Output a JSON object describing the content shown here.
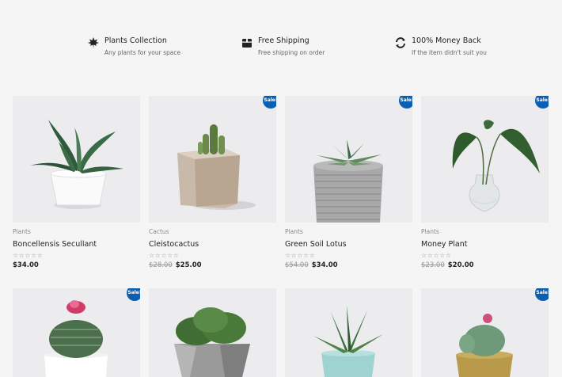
{
  "features": [
    {
      "icon": "leaf-icon",
      "title": "Plants Collection",
      "subtitle": "Any plants for your space"
    },
    {
      "icon": "box-icon",
      "title": "Free Shipping",
      "subtitle": "Free shipping on order"
    },
    {
      "icon": "refresh-icon",
      "title": "100% Money Back",
      "subtitle": "If the item didn't suit you"
    }
  ],
  "products": [
    {
      "category": "Plants",
      "name": "Boncellensis Secullant",
      "stars": "☆☆☆☆☆",
      "price": "$34.00",
      "old_price": "",
      "sale": false
    },
    {
      "category": "Cactus",
      "name": "Cleistocactus",
      "stars": "☆☆☆☆☆",
      "price": "$25.00",
      "old_price": "$28.00",
      "sale": true,
      "badge": "Sale!"
    },
    {
      "category": "Plants",
      "name": "Green Soil Lotus",
      "stars": "☆☆☆☆☆",
      "price": "$34.00",
      "old_price": "$54.00",
      "sale": true,
      "badge": "Sale!"
    },
    {
      "category": "Plants",
      "name": "Money Plant",
      "stars": "☆☆☆☆☆",
      "price": "$20.00",
      "old_price": "$23.00",
      "sale": true,
      "badge": "Sale!"
    }
  ],
  "products_row2": [
    {
      "sale": true,
      "badge": "Sale!"
    },
    {
      "sale": false
    },
    {
      "sale": false
    },
    {
      "sale": true,
      "badge": "Sale!"
    }
  ],
  "colors": {
    "badge": "#0b5fb3",
    "background": "#f5f5f6",
    "image_bg": "#ecebed"
  }
}
